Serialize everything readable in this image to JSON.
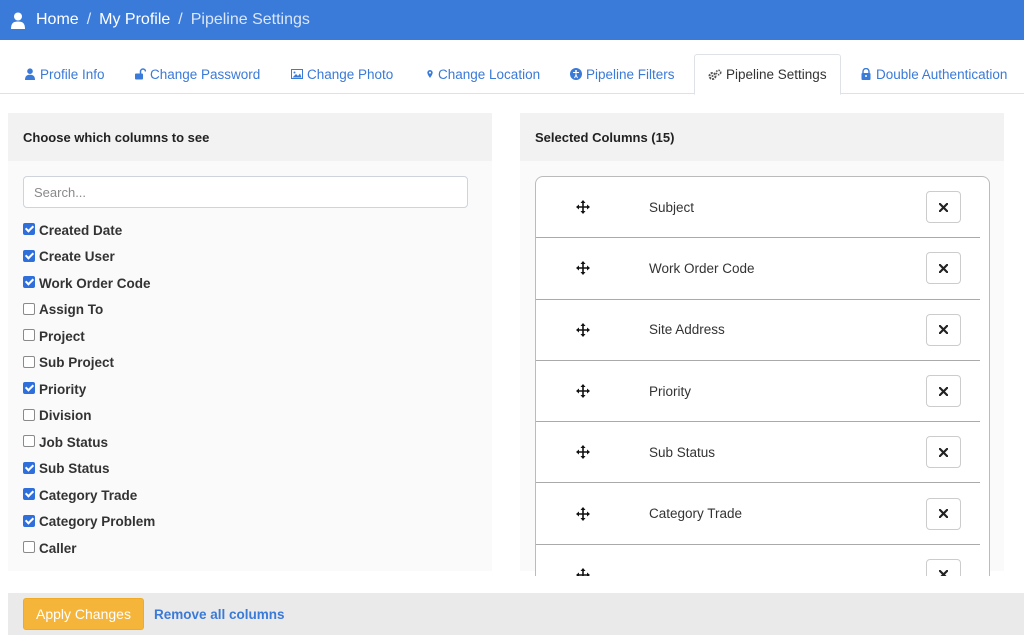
{
  "breadcrumb": [
    "Home",
    "My Profile",
    "Pipeline Settings"
  ],
  "tabs": [
    {
      "label": "Profile Info",
      "icon": "user-icon"
    },
    {
      "label": "Change Password",
      "icon": "unlock-icon"
    },
    {
      "label": "Change Photo",
      "icon": "image-icon"
    },
    {
      "label": "Change Location",
      "icon": "map-marker-icon"
    },
    {
      "label": "Pipeline Filters",
      "icon": "universal-access-icon"
    },
    {
      "label": "Pipeline Settings",
      "icon": "gears-icon"
    },
    {
      "label": "Double Authentication",
      "icon": "user-lock-icon"
    }
  ],
  "left_panel": {
    "title": "Choose which columns to see",
    "search_placeholder": "Search...",
    "items": [
      {
        "label": "Created Date",
        "checked": true
      },
      {
        "label": "Create User",
        "checked": true
      },
      {
        "label": "Work Order Code",
        "checked": true
      },
      {
        "label": "Assign To",
        "checked": false
      },
      {
        "label": "Project",
        "checked": false
      },
      {
        "label": "Sub Project",
        "checked": false
      },
      {
        "label": "Priority",
        "checked": true
      },
      {
        "label": "Division",
        "checked": false
      },
      {
        "label": "Job Status",
        "checked": false
      },
      {
        "label": "Sub Status",
        "checked": true
      },
      {
        "label": "Category Trade",
        "checked": true
      },
      {
        "label": "Category Problem",
        "checked": true
      },
      {
        "label": "Caller",
        "checked": false
      }
    ]
  },
  "right_panel": {
    "title": "Selected Columns (15)",
    "items": [
      "Subject",
      "Work Order Code",
      "Site Address",
      "Priority",
      "Sub Status",
      "Category Trade",
      ""
    ]
  },
  "footer": {
    "apply_label": "Apply Changes",
    "remove_all_label": "Remove all columns"
  },
  "colors": {
    "primary": "#3a7ad8",
    "apply": "#f5b53a",
    "checkbox": "#2f6fdb"
  }
}
